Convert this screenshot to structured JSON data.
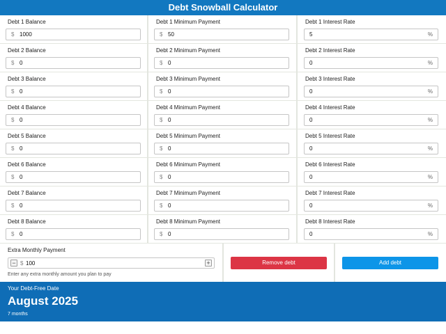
{
  "title": "Debt Snowball Calculator",
  "currency_symbol": "$",
  "percent_symbol": "%",
  "debts": [
    {
      "balance_label": "Debt 1 Balance",
      "balance": "1000",
      "min_label": "Debt 1 Minimum Payment",
      "min": "50",
      "rate_label": "Debt 1 Interest Rate",
      "rate": "5"
    },
    {
      "balance_label": "Debt 2 Balance",
      "balance": "0",
      "min_label": "Debt 2 Minimum Payment",
      "min": "0",
      "rate_label": "Debt 2 Interest Rate",
      "rate": "0"
    },
    {
      "balance_label": "Debt 3 Balance",
      "balance": "0",
      "min_label": "Debt 3 Minimum Payment",
      "min": "0",
      "rate_label": "Debt 3 Interest Rate",
      "rate": "0"
    },
    {
      "balance_label": "Debt 4 Balance",
      "balance": "0",
      "min_label": "Debt 4 Minimum Payment",
      "min": "0",
      "rate_label": "Debt 4 Interest Rate",
      "rate": "0"
    },
    {
      "balance_label": "Debt 5 Balance",
      "balance": "0",
      "min_label": "Debt 5 Minimum Payment",
      "min": "0",
      "rate_label": "Debt 5 Interest Rate",
      "rate": "0"
    },
    {
      "balance_label": "Debt 6 Balance",
      "balance": "0",
      "min_label": "Debt 6 Minimum Payment",
      "min": "0",
      "rate_label": "Debt 6 Interest Rate",
      "rate": "0"
    },
    {
      "balance_label": "Debt 7 Balance",
      "balance": "0",
      "min_label": "Debt 7 Minimum Payment",
      "min": "0",
      "rate_label": "Debt 7 Interest Rate",
      "rate": "0"
    },
    {
      "balance_label": "Debt 8 Balance",
      "balance": "0",
      "min_label": "Debt 8 Minimum Payment",
      "min": "0",
      "rate_label": "Debt 8 Interest Rate",
      "rate": "0"
    }
  ],
  "extra": {
    "label": "Extra Monthly Payment",
    "value": "100",
    "minus": "−",
    "plus": "+",
    "help": "Enter any extra monthly amount you plan to pay"
  },
  "buttons": {
    "remove_label": "Remove debt",
    "remove_color": "#dc3545",
    "add_label": "Add debt",
    "add_color": "#0d95e8"
  },
  "result": {
    "label": "Your Debt-Free Date",
    "date": "August 2025",
    "months": "7 months"
  }
}
